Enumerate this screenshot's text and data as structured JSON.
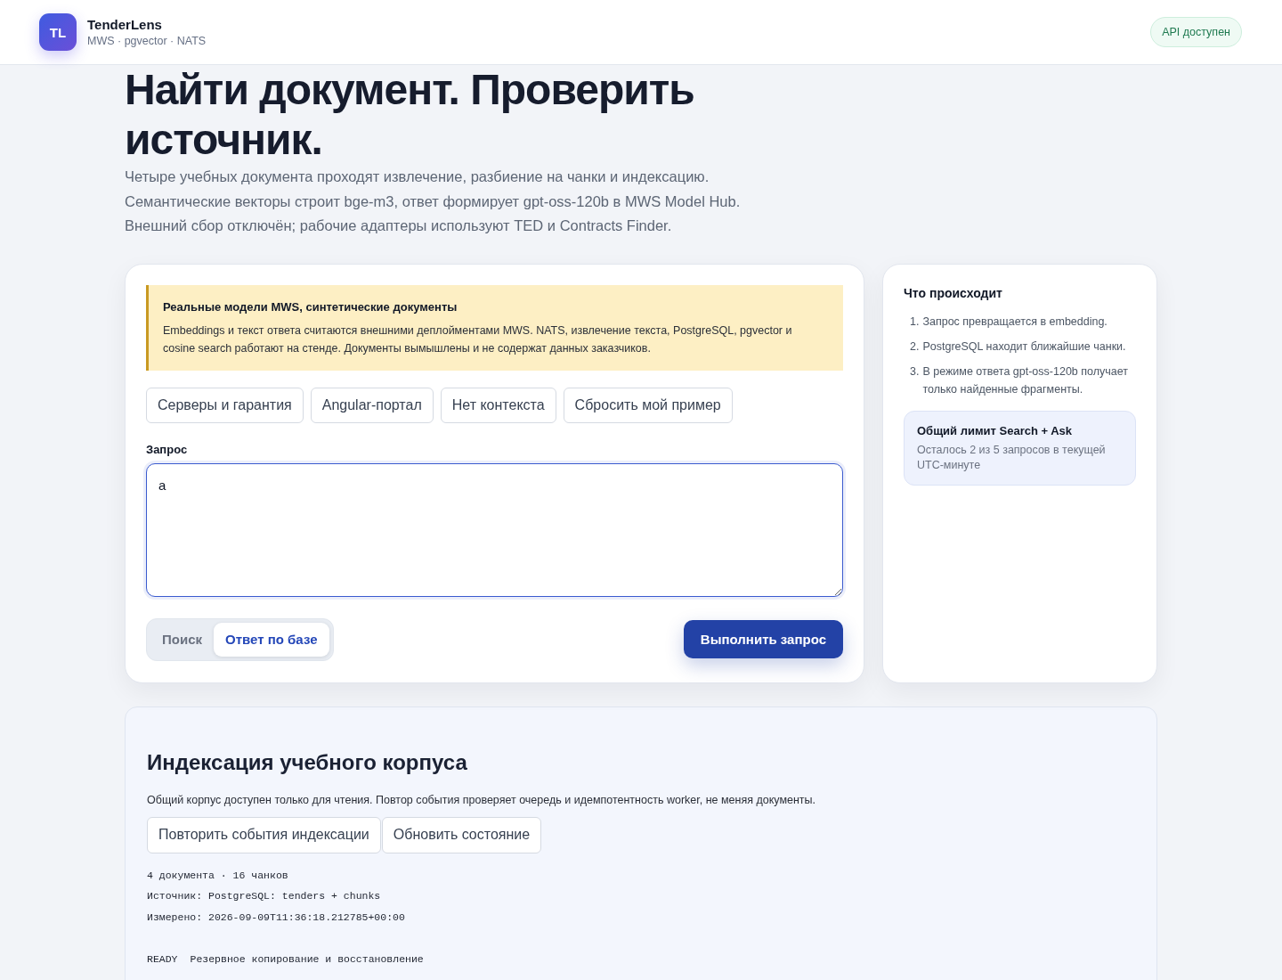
{
  "header": {
    "logo_text": "TL",
    "brand": "TenderLens",
    "subtitle": "MWS · pgvector · NATS",
    "api_status": "API доступен"
  },
  "hero": {
    "title": "Найти документ. Проверить источник.",
    "intro": [
      "Четыре учебных документа проходят извлечение, разбиение на чанки и индексацию.",
      "Семантические векторы строит bge-m3, ответ формирует gpt-oss-120b в MWS Model Hub.",
      "Внешний сбор отключён; рабочие адаптеры используют TED и Contracts Finder."
    ]
  },
  "query_panel": {
    "notice": {
      "title": "Реальные модели MWS, синтетические документы",
      "text": "Embeddings и текст ответа считаются внешними деплойментами MWS. NATS, извлечение текста, PostgreSQL, pgvector и cosine search работают на стенде. Документы вымышлены и не содержат данных заказчиков."
    },
    "presets": [
      {
        "label": "Серверы и гарантия"
      },
      {
        "label": "Angular-портал"
      },
      {
        "label": "Нет контекста"
      },
      {
        "label": "Сбросить мой пример"
      }
    ],
    "query": {
      "label": "Запрос",
      "value": "a"
    },
    "modes": [
      {
        "label": "Поиск",
        "selected": false
      },
      {
        "label": "Ответ по базе",
        "selected": true
      }
    ],
    "submit": "Выполнить запрос"
  },
  "info_panel": {
    "title": "Что происходит",
    "steps": [
      {
        "number": "1.",
        "text": "Запрос превращается в embedding."
      },
      {
        "number": "2.",
        "text": "PostgreSQL находит ближайшие чанки."
      },
      {
        "number": "3.",
        "text": "В режиме ответа gpt-oss-120b получает только найденные фрагменты."
      }
    ],
    "limit": {
      "title": "Общий лимит Search + Ask",
      "text": "Осталось 2 из 5 запросов в текущей UTC-минуте"
    }
  },
  "indexing": {
    "title": "Индексация учебного корпуса",
    "description": "Общий корпус доступен только для чтения. Повтор события проверяет очередь и идемпотентность worker, не меняя документы.",
    "buttons": [
      {
        "label": "Повторить события индексации"
      },
      {
        "label": "Обновить состояние"
      }
    ],
    "summary_lines": [
      "4 документа · 16 чанков",
      "Источник: PostgreSQL: tenders + chunks",
      "Измерено: 2026-09-09T11:36:18.212785+00:00"
    ],
    "documents": [
      {
        "status": "READY",
        "name": "Резервное копирование и восстановление"
      }
    ]
  }
}
